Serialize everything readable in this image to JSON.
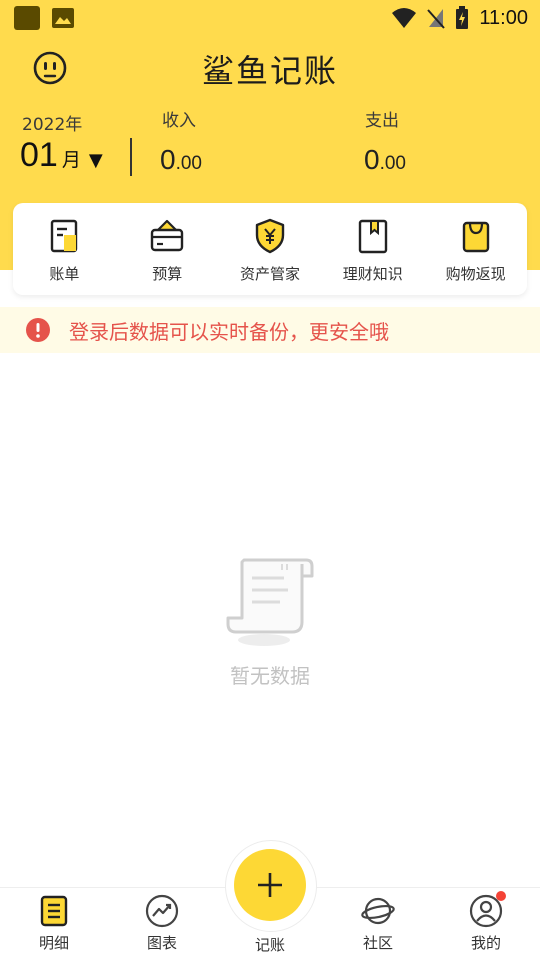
{
  "status_bar": {
    "time": "11:00"
  },
  "header": {
    "app_title": "鲨鱼记账",
    "year_label": "2022年",
    "month_value": "01",
    "month_unit": "月",
    "month_caret": "▼",
    "income_label": "收入",
    "income_int": "0",
    "income_dec": ".00",
    "expense_label": "支出",
    "expense_int": "0",
    "expense_dec": ".00",
    "accent_color": "#ffdb4d"
  },
  "shortcuts": [
    {
      "label": "账单",
      "icon": "bill-icon"
    },
    {
      "label": "预算",
      "icon": "wallet-icon"
    },
    {
      "label": "资产管家",
      "icon": "shield-yen-icon"
    },
    {
      "label": "理财知识",
      "icon": "bookmark-book-icon"
    },
    {
      "label": "购物返现",
      "icon": "shopping-bag-icon"
    }
  ],
  "notice": {
    "text": "登录后数据可以实时备份，更安全哦",
    "color": "#e5534b"
  },
  "empty_state": {
    "text": "暂无数据",
    "icon": "scroll-icon"
  },
  "tab_bar": {
    "tabs": [
      {
        "label": "明细",
        "icon": "list-icon"
      },
      {
        "label": "图表",
        "icon": "trend-chart-icon"
      },
      {
        "label": "记账",
        "icon": "plus-icon"
      },
      {
        "label": "社区",
        "icon": "planet-icon"
      },
      {
        "label": "我的",
        "icon": "user-icon"
      }
    ]
  }
}
